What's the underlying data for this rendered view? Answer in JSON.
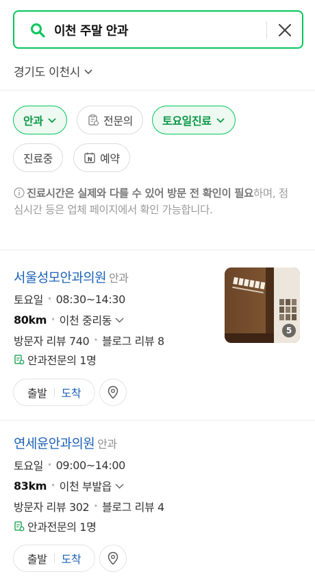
{
  "search": {
    "query": "이천 주말 안과"
  },
  "region": {
    "label": "경기도 이천시"
  },
  "filters": {
    "department": "안과",
    "specialist": "전문의",
    "saturday": "토요일진료",
    "open_now": "진료중",
    "reserve": "예약"
  },
  "notice": {
    "strong": "진료시간은 실제와 다를 수 있어 방문 전 확인이 필요",
    "rest": "하며, 점심시간 등은 업체 페이지에서 확인 가능합니다."
  },
  "results": [
    {
      "name": "서울성모안과의원",
      "category": "안과",
      "day": "토요일",
      "hours": "08:30~14:30",
      "distance": "80km",
      "address": "이천 중리동",
      "visitor_reviews": "방문자 리뷰 740",
      "blog_reviews": "블로그 리뷰 8",
      "specialist": "안과전문의 1명",
      "photo_count": "5",
      "depart": "출발",
      "arrive": "도착"
    },
    {
      "name": "연세윤안과의원",
      "category": "안과",
      "day": "토요일",
      "hours": "09:00~14:00",
      "distance": "83km",
      "address": "이천 부발읍",
      "visitor_reviews": "방문자 리뷰 302",
      "blog_reviews": "블로그 리뷰 4",
      "specialist": "안과전문의 1명",
      "depart": "출발",
      "arrive": "도착"
    }
  ],
  "colors": {
    "accent": "#03c75a",
    "link": "#1a61b6"
  }
}
